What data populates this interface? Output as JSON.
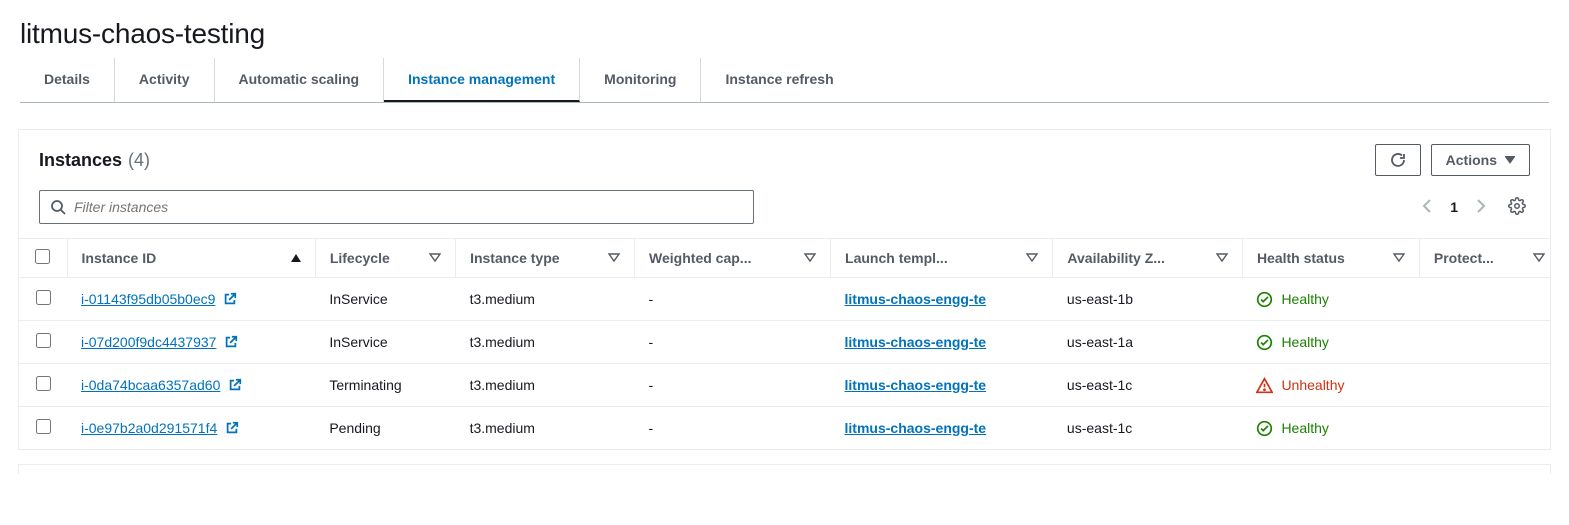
{
  "header": {
    "title": "litmus-chaos-testing"
  },
  "tabs": [
    {
      "id": "details",
      "label": "Details",
      "active": false
    },
    {
      "id": "activity",
      "label": "Activity",
      "active": false
    },
    {
      "id": "scaling",
      "label": "Automatic scaling",
      "active": false
    },
    {
      "id": "instances",
      "label": "Instance management",
      "active": true
    },
    {
      "id": "monitoring",
      "label": "Monitoring",
      "active": false
    },
    {
      "id": "refresh",
      "label": "Instance refresh",
      "active": false
    }
  ],
  "panel": {
    "title": "Instances",
    "count_display": "(4)",
    "count": 4,
    "actions_label": "Actions",
    "search_placeholder": "Filter instances",
    "page_number": "1"
  },
  "columns": {
    "instance_id": "Instance ID",
    "lifecycle": "Lifecycle",
    "instance_type": "Instance type",
    "weighted_capacity": "Weighted cap...",
    "launch_template": "Launch templ...",
    "availability_zone": "Availability Z...",
    "health_status": "Health status",
    "protected": "Protect..."
  },
  "rows": [
    {
      "instance_id": "i-01143f95db05b0ec9",
      "lifecycle": "InService",
      "instance_type": "t3.medium",
      "weighted_capacity": "-",
      "launch_template": "litmus-chaos-engg-te",
      "availability_zone": "us-east-1b",
      "health_status": "Healthy",
      "health_kind": "healthy"
    },
    {
      "instance_id": "i-07d200f9dc4437937",
      "lifecycle": "InService",
      "instance_type": "t3.medium",
      "weighted_capacity": "-",
      "launch_template": "litmus-chaos-engg-te",
      "availability_zone": "us-east-1a",
      "health_status": "Healthy",
      "health_kind": "healthy"
    },
    {
      "instance_id": "i-0da74bcaa6357ad60",
      "lifecycle": "Terminating",
      "instance_type": "t3.medium",
      "weighted_capacity": "-",
      "launch_template": "litmus-chaos-engg-te",
      "availability_zone": "us-east-1c",
      "health_status": "Unhealthy",
      "health_kind": "unhealthy"
    },
    {
      "instance_id": "i-0e97b2a0d291571f4",
      "lifecycle": "Pending",
      "instance_type": "t3.medium",
      "weighted_capacity": "-",
      "launch_template": "litmus-chaos-engg-te",
      "availability_zone": "us-east-1c",
      "health_status": "Healthy",
      "health_kind": "healthy"
    }
  ]
}
